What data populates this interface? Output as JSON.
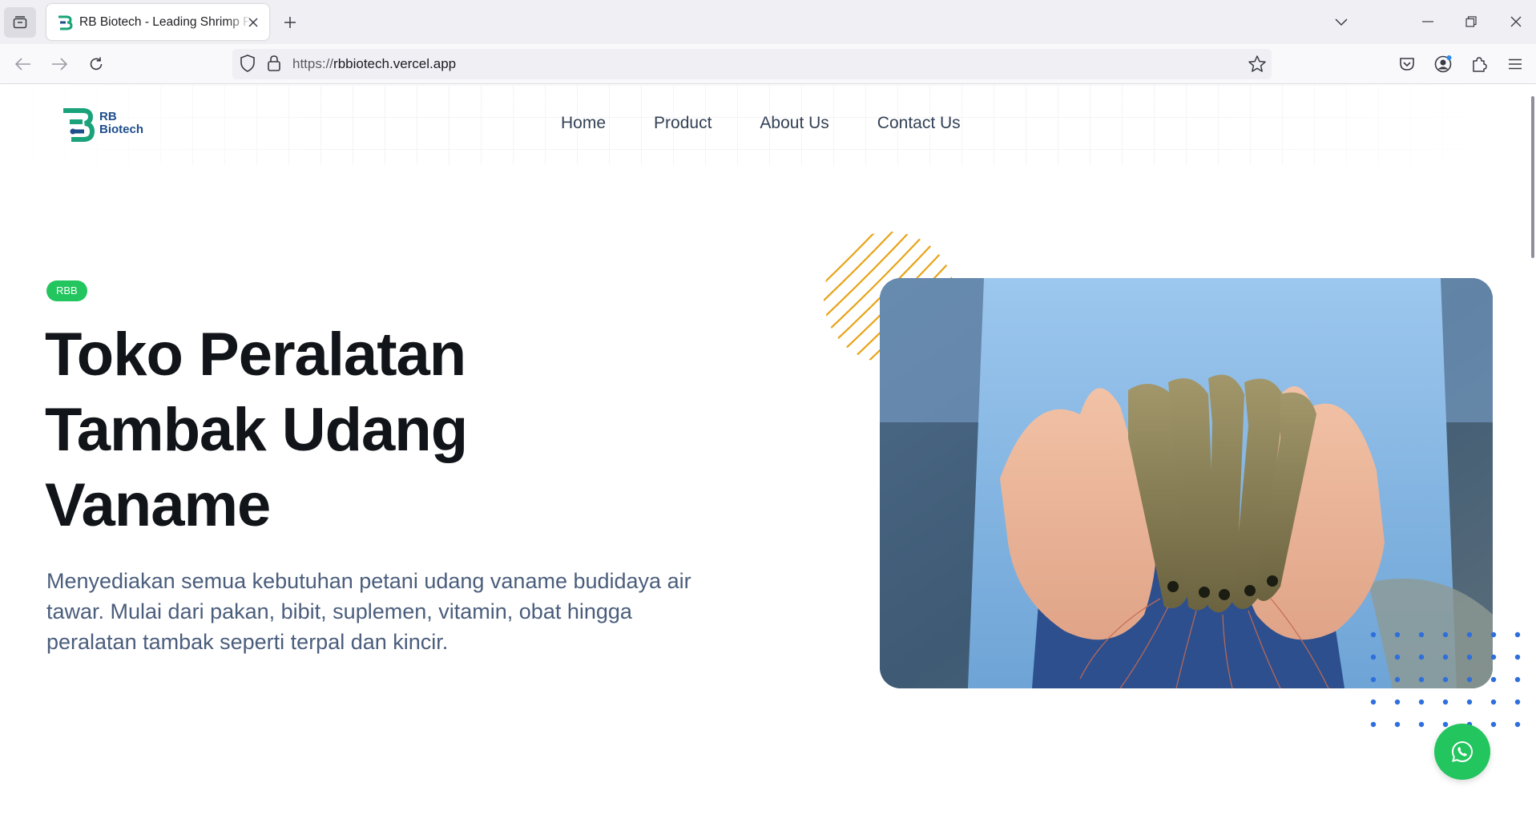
{
  "browser": {
    "tab": {
      "title": "RB Biotech - Leading Shrimp Farm",
      "favicon": "rb-biotech-logo"
    },
    "url": {
      "scheme": "https://",
      "host": "rbbiotech.vercel.app"
    },
    "icons": [
      "tab-list-icon",
      "close-icon",
      "plus-icon",
      "chevron-down-icon",
      "minimize-icon",
      "restore-icon",
      "window-close-icon",
      "back-arrow-icon",
      "forward-arrow-icon",
      "reload-icon",
      "shield-icon",
      "lock-icon",
      "star-icon",
      "pocket-icon",
      "account-icon",
      "extensions-icon",
      "menu-icon"
    ]
  },
  "site": {
    "logo": {
      "line1": "RB",
      "line2": "Biotech"
    },
    "nav": [
      {
        "label": "Home"
      },
      {
        "label": "Product"
      },
      {
        "label": "About Us"
      },
      {
        "label": "Contact Us"
      }
    ],
    "hero": {
      "badge": "RBB",
      "title_line1": "Toko Peralatan",
      "title_line2": "Tambak Udang",
      "title_line3": "Vaname",
      "description_line1": "Menyediakan semua kebutuhan petani udang vaname budidaya air",
      "description_line2": "tawar. Mulai dari pakan, bibit, suplemen, vitamin, obat hingga",
      "description_line3": "peralatan tambak seperti terpal dan kincir.",
      "image": "hands-holding-shrimp-photo"
    },
    "whatsapp": {
      "icon": "whatsapp-icon"
    }
  },
  "colors": {
    "accent_green": "#22c55e",
    "logo_blue": "#1e4e8c",
    "logo_teal": "#1aa37a",
    "arc_orange": "#e8a317",
    "dot_blue": "#2f6fdc",
    "title_dark": "#111418",
    "desc_slate": "#4a5d7c"
  }
}
